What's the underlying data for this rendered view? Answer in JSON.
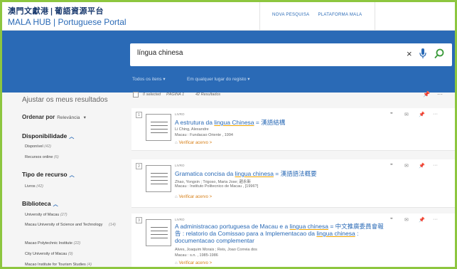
{
  "header": {
    "logo_cn": "澳門文獻港",
    "logo_sep": "|",
    "logo_cn2": "葡語資源平台",
    "logo_en": "MALA HUB",
    "logo_en2": "Portuguese Portal",
    "nav": [
      "NOVA PESQUISA",
      "PLATAFORMA MALA"
    ]
  },
  "search": {
    "query": "língua chinesa",
    "clear_icon": "close-icon",
    "mic_icon": "microphone-icon",
    "search_icon": "search-icon",
    "scope1": "Todos os itens",
    "scope2": "Em qualquer lugar do registo"
  },
  "refine": {
    "title": "Ajustar os meus resultados",
    "sort_label": "Ordenar por",
    "sort_value": "Relevância",
    "facets": [
      {
        "heading": "Disponibilidade",
        "items": [
          {
            "label": "Disponível",
            "count": "(42)"
          },
          {
            "label": "Recursos online",
            "count": "(6)"
          }
        ]
      },
      {
        "heading": "Tipo de recurso",
        "items": [
          {
            "label": "Livros",
            "count": "(42)"
          }
        ]
      },
      {
        "heading": "Biblioteca",
        "items": [
          {
            "label": "University of Macau",
            "count": "(27)"
          },
          {
            "label": "Macau University of Science and Technology",
            "count": "(14)"
          },
          {
            "label": "Macao Polytechnic Institute",
            "count": "(22)"
          },
          {
            "label": "City University of Macau",
            "count": "(9)"
          },
          {
            "label": "Macao Institute for Tourism Studies",
            "count": "(4)"
          }
        ]
      }
    ]
  },
  "results_head": {
    "selected": "0 selected",
    "page": "PÁGINA 1",
    "count": "42 Resultados"
  },
  "results": [
    {
      "num": "1",
      "type": "LIVRO",
      "title_pre": "A estrutura da ",
      "title_hl": "lingua Chinesa",
      "title_post": " = 漢語結構",
      "author": "Li Ching, Alexandre",
      "pub": "Macau : Fundacao Oriente , 1994",
      "access": "Verificar acervo",
      "access_arrow": ">"
    },
    {
      "num": "2",
      "type": "LIVRO",
      "title_pre": "Gramatica concisa da ",
      "title_hl": "lingua chinesa",
      "title_post": " = 漢語語法概要",
      "author": "Zhao, Yongxin ; Trigoso, Maria Jose; 趙永新",
      "pub": "Macau : Instituto Politecnico de Macau , [1996?]",
      "access": "Verificar acervo",
      "access_arrow": ">"
    },
    {
      "num": "3",
      "type": "LIVRO",
      "title_pre": "A administracao portuguesa de Macau e a ",
      "title_hl": "lingua chinesa",
      "title_post": " = 中文推廣委員會報告 : relatorio da Comissao para a Implementacao da ",
      "title_hl2": "lingua chinesa",
      "title_post2": " : documentacao complementar",
      "author": "Alves, Joaquim Morais ; Reis, Joao Correia dos",
      "pub": "Macau : s.n. , 1985-1986",
      "access": "Verificar acervo",
      "access_arrow": ">"
    }
  ],
  "colors": {
    "brand_blue": "#2a6ab6",
    "accent_orange": "#d67d14",
    "frame_green": "#8dc63f"
  }
}
